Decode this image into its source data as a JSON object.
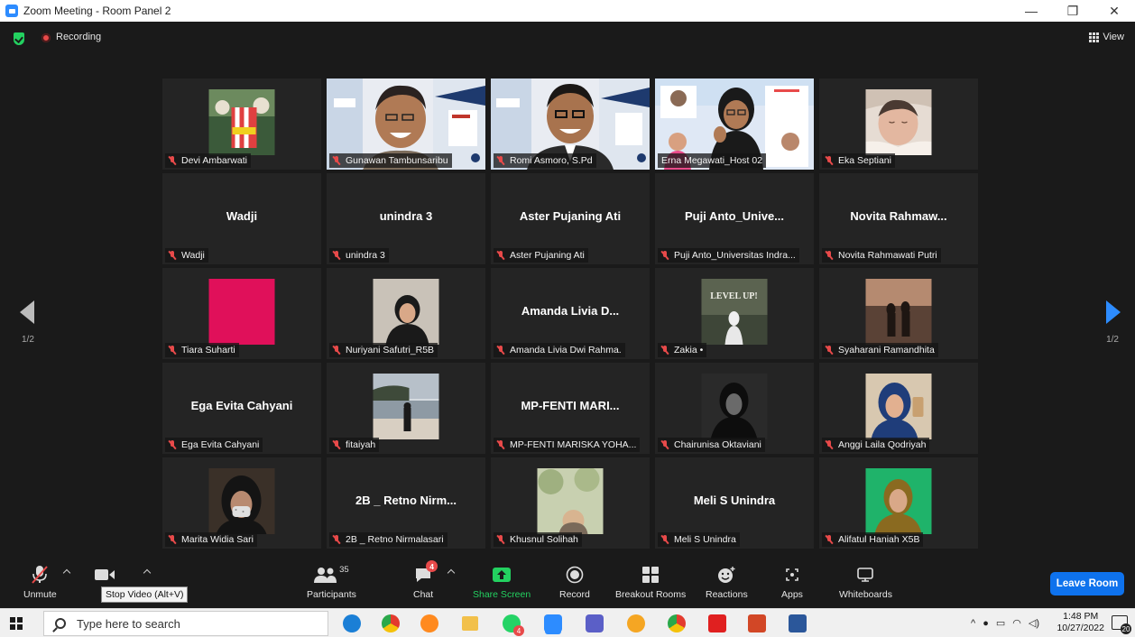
{
  "window": {
    "title": "Zoom Meeting - Room Panel 2",
    "controls": [
      "—",
      "❐",
      "✕"
    ]
  },
  "topbar": {
    "recording_label": "Recording",
    "view_label": "View"
  },
  "pagination": {
    "left": "1/2",
    "right": "1/2"
  },
  "participants": [
    {
      "name": "Devi Ambarwati",
      "display": "",
      "video": "photo",
      "muted": true
    },
    {
      "name": "Gunawan Tambunsaribu",
      "display": "",
      "video": "camera",
      "muted": true
    },
    {
      "name": "Romi Asmoro, S.Pd",
      "display": "",
      "video": "camera",
      "muted": true
    },
    {
      "name": "Erna Megawati_Host 02",
      "display": "",
      "video": "camera",
      "muted": false,
      "active_speaker": true
    },
    {
      "name": "Eka Septiani",
      "display": "",
      "video": "photo",
      "muted": true
    },
    {
      "name": "Wadji",
      "display": "Wadji",
      "video": "none",
      "muted": true
    },
    {
      "name": "unindra 3",
      "display": "unindra 3",
      "video": "none",
      "muted": true
    },
    {
      "name": "Aster Pujaning Ati",
      "display": "Aster Pujaning Ati",
      "video": "none",
      "muted": true
    },
    {
      "name": "Puji Anto_Universitas Indra...",
      "display": "Puji  Anto_Unive...",
      "video": "none",
      "muted": true
    },
    {
      "name": "Novita Rahmawati Putri",
      "display": "Novita  Rahmaw...",
      "video": "none",
      "muted": true
    },
    {
      "name": "Tiara Suharti",
      "display": "",
      "video": "photo",
      "muted": true
    },
    {
      "name": "Nuriyani Safutri_R5B",
      "display": "",
      "video": "photo",
      "muted": true
    },
    {
      "name": "Amanda Livia Dwi Rahma.",
      "display": "Amanda  Livia  D...",
      "video": "none",
      "muted": true
    },
    {
      "name": "Zakia •",
      "display": "",
      "video": "photo",
      "muted": true
    },
    {
      "name": "Syaharani Ramandhita",
      "display": "",
      "video": "photo",
      "muted": true
    },
    {
      "name": "Ega Evita Cahyani",
      "display": "Ega Evita Cahyani",
      "video": "none",
      "muted": true
    },
    {
      "name": "fitaiyah",
      "display": "",
      "video": "photo",
      "muted": true
    },
    {
      "name": "MP-FENTI MARISKA YOHA...",
      "display": "MP-FENTI  MARI...",
      "video": "none",
      "muted": true
    },
    {
      "name": "Chairunisa Oktaviani",
      "display": "",
      "video": "photo",
      "muted": true
    },
    {
      "name": "Anggi Laila Qodriyah",
      "display": "",
      "video": "photo",
      "muted": true
    },
    {
      "name": "Marita Widia Sari",
      "display": "",
      "video": "photo",
      "muted": true
    },
    {
      "name": "2B _ Retno Nirmalasari",
      "display": "2B _ Retno  Nirm...",
      "video": "none",
      "muted": true
    },
    {
      "name": "Khusnul Solihah",
      "display": "",
      "video": "photo",
      "muted": true
    },
    {
      "name": "Meli S Unindra",
      "display": "Meli S Unindra",
      "video": "none",
      "muted": true
    },
    {
      "name": "Alifatul Haniah X5B",
      "display": "",
      "video": "photo",
      "muted": true
    }
  ],
  "toolbar": {
    "unmute": "Unmute",
    "stop_video": "S",
    "tooltip": "Stop Video (Alt+V)",
    "participants": "Participants",
    "participants_count": "35",
    "chat": "Chat",
    "chat_badge": "4",
    "share": "Share Screen",
    "record": "Record",
    "breakout": "Breakout Rooms",
    "reactions": "Reactions",
    "apps": "Apps",
    "whiteboards": "Whiteboards",
    "leave": "Leave Room"
  },
  "taskbar": {
    "search_placeholder": "Type here to search",
    "time": "1:48 PM",
    "date": "10/27/2022",
    "notification_count": "20",
    "whatsapp_badge": "4"
  },
  "colors": {
    "accent": "#2D8CFF",
    "share": "#23d160",
    "muted": "#e84a4a",
    "active_border": "#f0e63a",
    "leave": "#0e72ed"
  }
}
